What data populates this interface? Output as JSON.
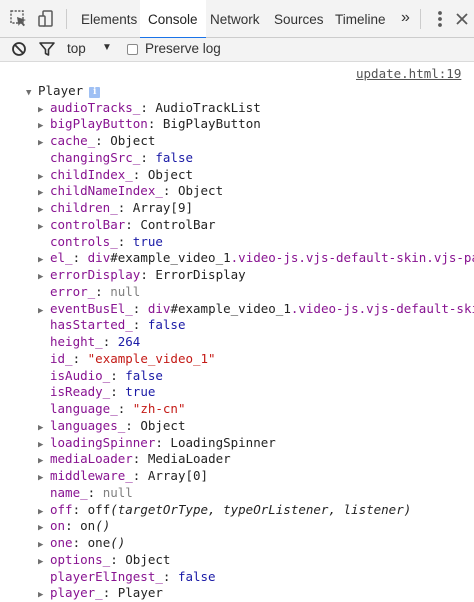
{
  "toolbar": {
    "tabs": [
      {
        "label": "Elements"
      },
      {
        "label": "Console"
      },
      {
        "label": "Network"
      },
      {
        "label": "Sources"
      },
      {
        "label": "Timeline"
      }
    ],
    "more_label": "»"
  },
  "console_toolbar": {
    "context": "top",
    "context_arrow": "▼",
    "preserve_log_label": "Preserve log",
    "preserve_log_checked": false
  },
  "output": {
    "source_link": "update.html:19",
    "object_name": "Player",
    "info_badge": "i",
    "properties": [
      {
        "expandable": true,
        "name": "audioTracks_",
        "sep": ": ",
        "value": "AudioTrackList",
        "type": "object"
      },
      {
        "expandable": true,
        "name": "bigPlayButton",
        "sep": ": ",
        "value": "BigPlayButton",
        "type": "object"
      },
      {
        "expandable": true,
        "name": "cache_",
        "sep": ": ",
        "value": "Object",
        "type": "object"
      },
      {
        "expandable": false,
        "name": "changingSrc_",
        "sep": ": ",
        "value": "false",
        "type": "bool"
      },
      {
        "expandable": true,
        "name": "childIndex_",
        "sep": ": ",
        "value": "Object",
        "type": "object"
      },
      {
        "expandable": true,
        "name": "childNameIndex_",
        "sep": ": ",
        "value": "Object",
        "type": "object"
      },
      {
        "expandable": true,
        "name": "children_",
        "sep": ": ",
        "value": "Array[9]",
        "type": "object"
      },
      {
        "expandable": true,
        "name": "controlBar",
        "sep": ": ",
        "value": "ControlBar",
        "type": "object"
      },
      {
        "expandable": false,
        "name": "controls_",
        "sep": ": ",
        "value": "true",
        "type": "bool"
      },
      {
        "expandable": true,
        "name": "el_",
        "sep": ": ",
        "value_parts": [
          {
            "t": "div",
            "c": "key"
          },
          {
            "t": "#example_video_1",
            "c": "plain"
          },
          {
            "t": ".video-js.vjs-default-skin.vjs-paused.",
            "c": "key"
          }
        ],
        "type": "element"
      },
      {
        "expandable": true,
        "name": "errorDisplay",
        "sep": ": ",
        "value": "ErrorDisplay",
        "type": "object"
      },
      {
        "expandable": false,
        "name": "error_",
        "sep": ": ",
        "value": "null",
        "type": "null"
      },
      {
        "expandable": true,
        "name": "eventBusEl_",
        "sep": ": ",
        "value_parts": [
          {
            "t": "div",
            "c": "key"
          },
          {
            "t": "#example_video_1",
            "c": "plain"
          },
          {
            "t": ".video-js.vjs-default-skin.vjs",
            "c": "key"
          }
        ],
        "type": "element"
      },
      {
        "expandable": false,
        "name": "hasStarted_",
        "sep": ": ",
        "value": "false",
        "type": "bool"
      },
      {
        "expandable": false,
        "name": "height_",
        "sep": ": ",
        "value": "264",
        "type": "num"
      },
      {
        "expandable": false,
        "name": "id_",
        "sep": ": ",
        "value": "\"example_video_1\"",
        "type": "str"
      },
      {
        "expandable": false,
        "name": "isAudio_",
        "sep": ": ",
        "value": "false",
        "type": "bool"
      },
      {
        "expandable": false,
        "name": "isReady_",
        "sep": ": ",
        "value": "true",
        "type": "bool"
      },
      {
        "expandable": false,
        "name": "language_",
        "sep": ": ",
        "value": "\"zh-cn\"",
        "type": "str"
      },
      {
        "expandable": true,
        "name": "languages_",
        "sep": ": ",
        "value": "Object",
        "type": "object"
      },
      {
        "expandable": true,
        "name": "loadingSpinner",
        "sep": ": ",
        "value": "LoadingSpinner",
        "type": "object"
      },
      {
        "expandable": true,
        "name": "mediaLoader",
        "sep": ": ",
        "value": "MediaLoader",
        "type": "object"
      },
      {
        "expandable": true,
        "name": "middleware_",
        "sep": ": ",
        "value": "Array[0]",
        "type": "object"
      },
      {
        "expandable": false,
        "name": "name_",
        "sep": ": ",
        "value": "null",
        "type": "null"
      },
      {
        "expandable": true,
        "name": "off",
        "sep": ": ",
        "value_parts": [
          {
            "t": "off",
            "c": "fkw"
          },
          {
            "t": "(targetOrType, typeOrListener, listener)",
            "c": "fn"
          }
        ],
        "type": "function"
      },
      {
        "expandable": true,
        "name": "on",
        "sep": ": ",
        "value_parts": [
          {
            "t": "on",
            "c": "fkw"
          },
          {
            "t": "()",
            "c": "fn"
          }
        ],
        "type": "function"
      },
      {
        "expandable": true,
        "name": "one",
        "sep": ": ",
        "value_parts": [
          {
            "t": "one",
            "c": "fkw"
          },
          {
            "t": "()",
            "c": "fn"
          }
        ],
        "type": "function"
      },
      {
        "expandable": true,
        "name": "options_",
        "sep": ": ",
        "value": "Object",
        "type": "object"
      },
      {
        "expandable": false,
        "name": "playerElIngest_",
        "sep": ": ",
        "value": "false",
        "type": "bool"
      },
      {
        "expandable": true,
        "name": "player_",
        "sep": ": ",
        "value": "Player",
        "type": "object"
      }
    ]
  }
}
